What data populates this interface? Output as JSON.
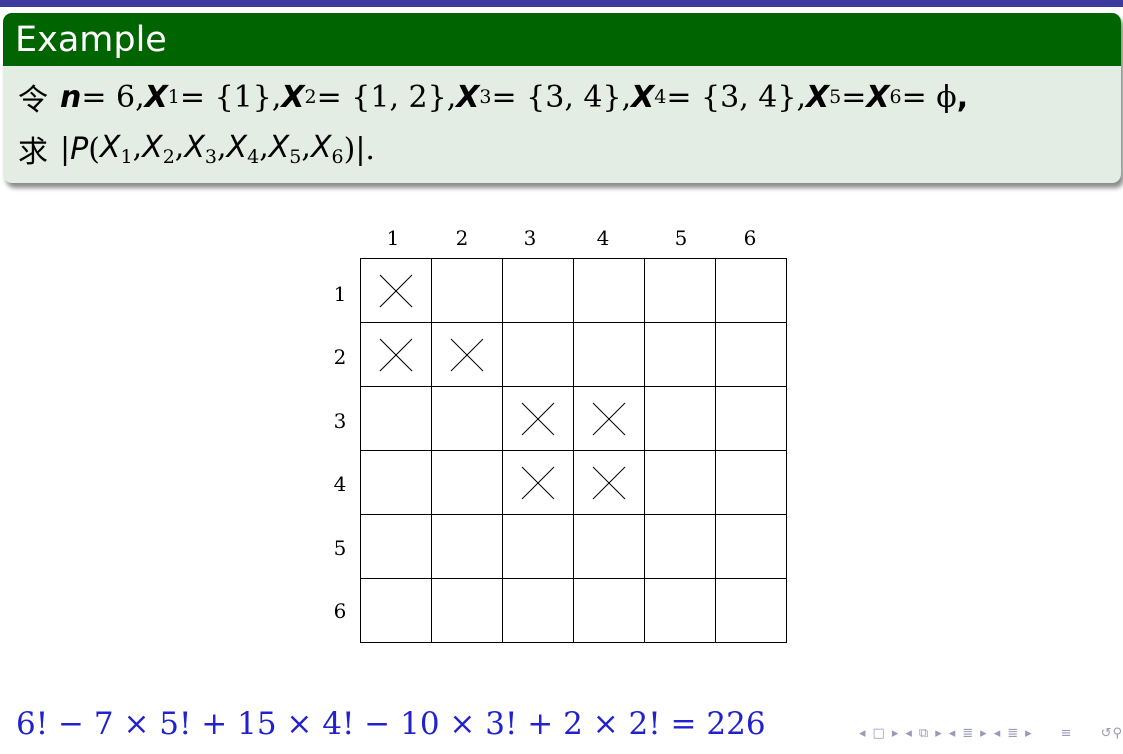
{
  "block": {
    "title": "Example",
    "line1": {
      "cjk": "令",
      "n": "n",
      "n_value": " = 6,",
      "x1": "X",
      "x1_sub": "1",
      "x1_value": " = {1},",
      "x2": "X",
      "x2_sub": "2",
      "x2_value": " = {1, 2},",
      "x3": "X",
      "x3_sub": "3",
      "x3_value": " = {3, 4},",
      "x4": "X",
      "x4_sub": "4",
      "x4_value": " = {3, 4},",
      "x5": "X",
      "x5_sub": "5",
      "x5_eq": " = ",
      "x6": "X",
      "x6_sub": "6",
      "x6_value": " = ϕ",
      "comma": ","
    },
    "line2": {
      "cjk": "求",
      "open": "|",
      "p": "P",
      "paren_open": "(",
      "args": [
        {
          "x": "X",
          "sub": "1",
          "sep": ","
        },
        {
          "x": "X",
          "sub": "2",
          "sep": ","
        },
        {
          "x": "X",
          "sub": "3",
          "sep": ","
        },
        {
          "x": "X",
          "sub": "4",
          "sep": ","
        },
        {
          "x": "X",
          "sub": "5",
          "sep": ","
        },
        {
          "x": "X",
          "sub": "6",
          "sep": ""
        }
      ],
      "paren_close": ")",
      "close": "|."
    }
  },
  "grid": {
    "col_labels": [
      "1",
      "2",
      "3",
      "4",
      "5",
      "6"
    ],
    "row_labels": [
      "1",
      "2",
      "3",
      "4",
      "5",
      "6"
    ],
    "forbidden": [
      [
        true,
        false,
        false,
        false,
        false,
        false
      ],
      [
        true,
        true,
        false,
        false,
        false,
        false
      ],
      [
        false,
        false,
        true,
        true,
        false,
        false
      ],
      [
        false,
        false,
        true,
        true,
        false,
        false
      ],
      [
        false,
        false,
        false,
        false,
        false,
        false
      ],
      [
        false,
        false,
        false,
        false,
        false,
        false
      ]
    ],
    "mark_icon": "cross-icon"
  },
  "result_formula": "6! − 7 × 5! + 15 × 4! − 10 × 3! + 2 × 2! = 226",
  "navigation": {
    "icons": [
      "prev-frame-icon",
      "frame-icon",
      "next-frame-icon",
      "prev-subsection-icon",
      "subsection-icon",
      "next-subsection-icon",
      "prev-section-icon",
      "section-icon",
      "next-section-icon",
      "prev-slide-icon",
      "slide-icon",
      "next-slide-icon",
      "toc-icon",
      "search-icon"
    ]
  },
  "colors": {
    "block_title_bg": "#006400",
    "block_body_bg": "#e3ede3",
    "formula_color": "#2222cc",
    "top_bar": "#3b3b9e"
  }
}
